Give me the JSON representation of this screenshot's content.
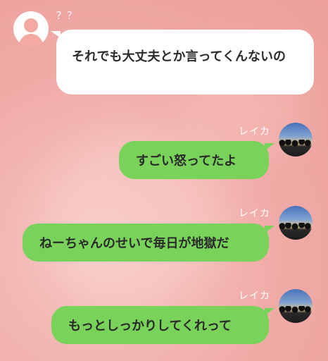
{
  "chat": {
    "incoming": {
      "sender": "？？",
      "avatar_icon": "default-user-icon",
      "text": "それでも大丈夫とか言ってくんないの"
    },
    "outgoing": [
      {
        "sender": "レイカ",
        "text": "すごい怒ってたよ"
      },
      {
        "sender": "レイカ",
        "text": "ねーちゃんのせいで毎日が地獄だ"
      },
      {
        "sender": "レイカ",
        "text": "もっとしっかりしてくれって"
      }
    ]
  },
  "colors": {
    "background": "#f0aaa6",
    "bubble_incoming": "#ffffff",
    "bubble_outgoing": "#79d35a"
  }
}
